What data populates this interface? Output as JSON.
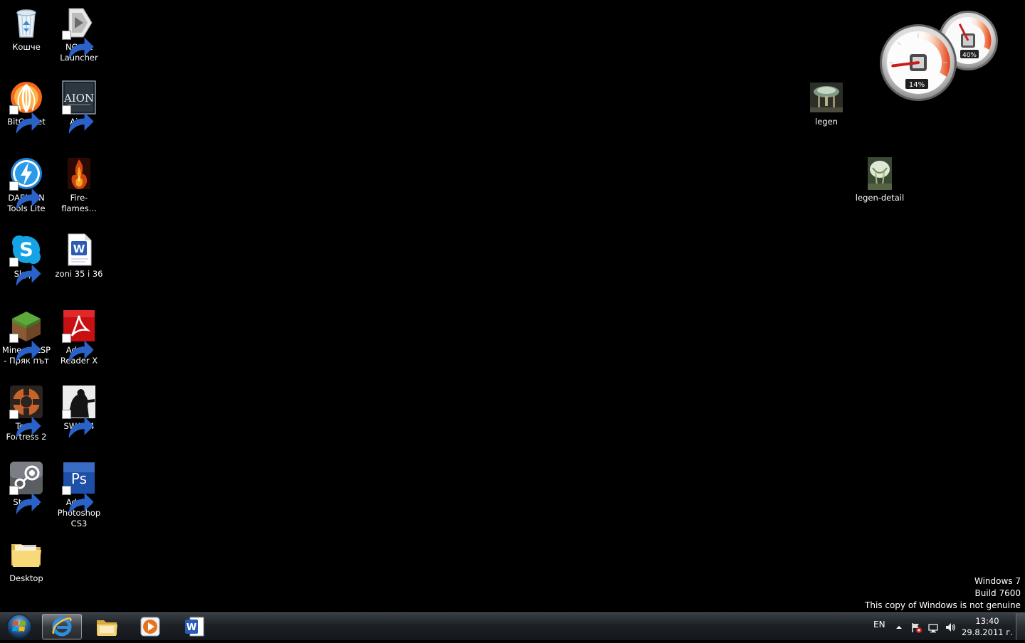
{
  "desktop_icons": [
    {
      "label": "Кошче",
      "icon": "recycle-bin-icon"
    },
    {
      "label": "NCsoft Launcher",
      "icon": "ncsoft-launcher-icon"
    },
    {
      "label": "BitComet",
      "icon": "bitcomet-icon"
    },
    {
      "label": "Aion",
      "icon": "aion-icon"
    },
    {
      "label": "DAEMON Tools Lite",
      "icon": "daemon-tools-icon"
    },
    {
      "label": "Fire-flames...",
      "icon": "fire-flames-image-icon"
    },
    {
      "label": "Skype",
      "icon": "skype-icon"
    },
    {
      "label": "zoni 35 i 36",
      "icon": "word-document-icon"
    },
    {
      "label": "MinecraftSP - Пряк път",
      "icon": "minecraft-icon"
    },
    {
      "label": "Adobe Reader X",
      "icon": "adobe-reader-icon"
    },
    {
      "label": "Team Fortress 2",
      "icon": "team-fortress-icon"
    },
    {
      "label": "SWAT 4",
      "icon": "swat4-icon"
    },
    {
      "label": "Steam",
      "icon": "steam-icon"
    },
    {
      "label": "Adobe Photoshop CS3",
      "icon": "photoshop-icon"
    },
    {
      "label": "Desktop",
      "icon": "folder-icon"
    },
    {
      "label": "legen",
      "icon": "image-thumbnail-icon"
    },
    {
      "label": "legen-detail",
      "icon": "image-thumbnail-icon"
    }
  ],
  "gadget": {
    "cpu_percent": 14,
    "memory_percent": 40,
    "cpu_label": "14%",
    "memory_label": "40%"
  },
  "watermark": {
    "line1": "Windows 7",
    "line2": "Build 7600",
    "line3": "This copy of Windows is not genuine"
  },
  "taskbar": {
    "pinned": [
      {
        "name": "internet-explorer",
        "icon": "internet-explorer-icon",
        "active": true
      },
      {
        "name": "windows-explorer",
        "icon": "windows-explorer-icon",
        "active": false
      },
      {
        "name": "media-player",
        "icon": "media-player-icon",
        "active": false
      },
      {
        "name": "microsoft-word",
        "icon": "word-icon",
        "active": false
      }
    ],
    "tray": {
      "language": "EN",
      "time": "13:40",
      "date": "29.8.2011 г."
    }
  },
  "colors": {
    "desktop_bg": "#000000",
    "taskbar_bg": "#1d2126",
    "gauge_red": "#c81e1e",
    "shortcut_arrow": "#2a62c8"
  }
}
